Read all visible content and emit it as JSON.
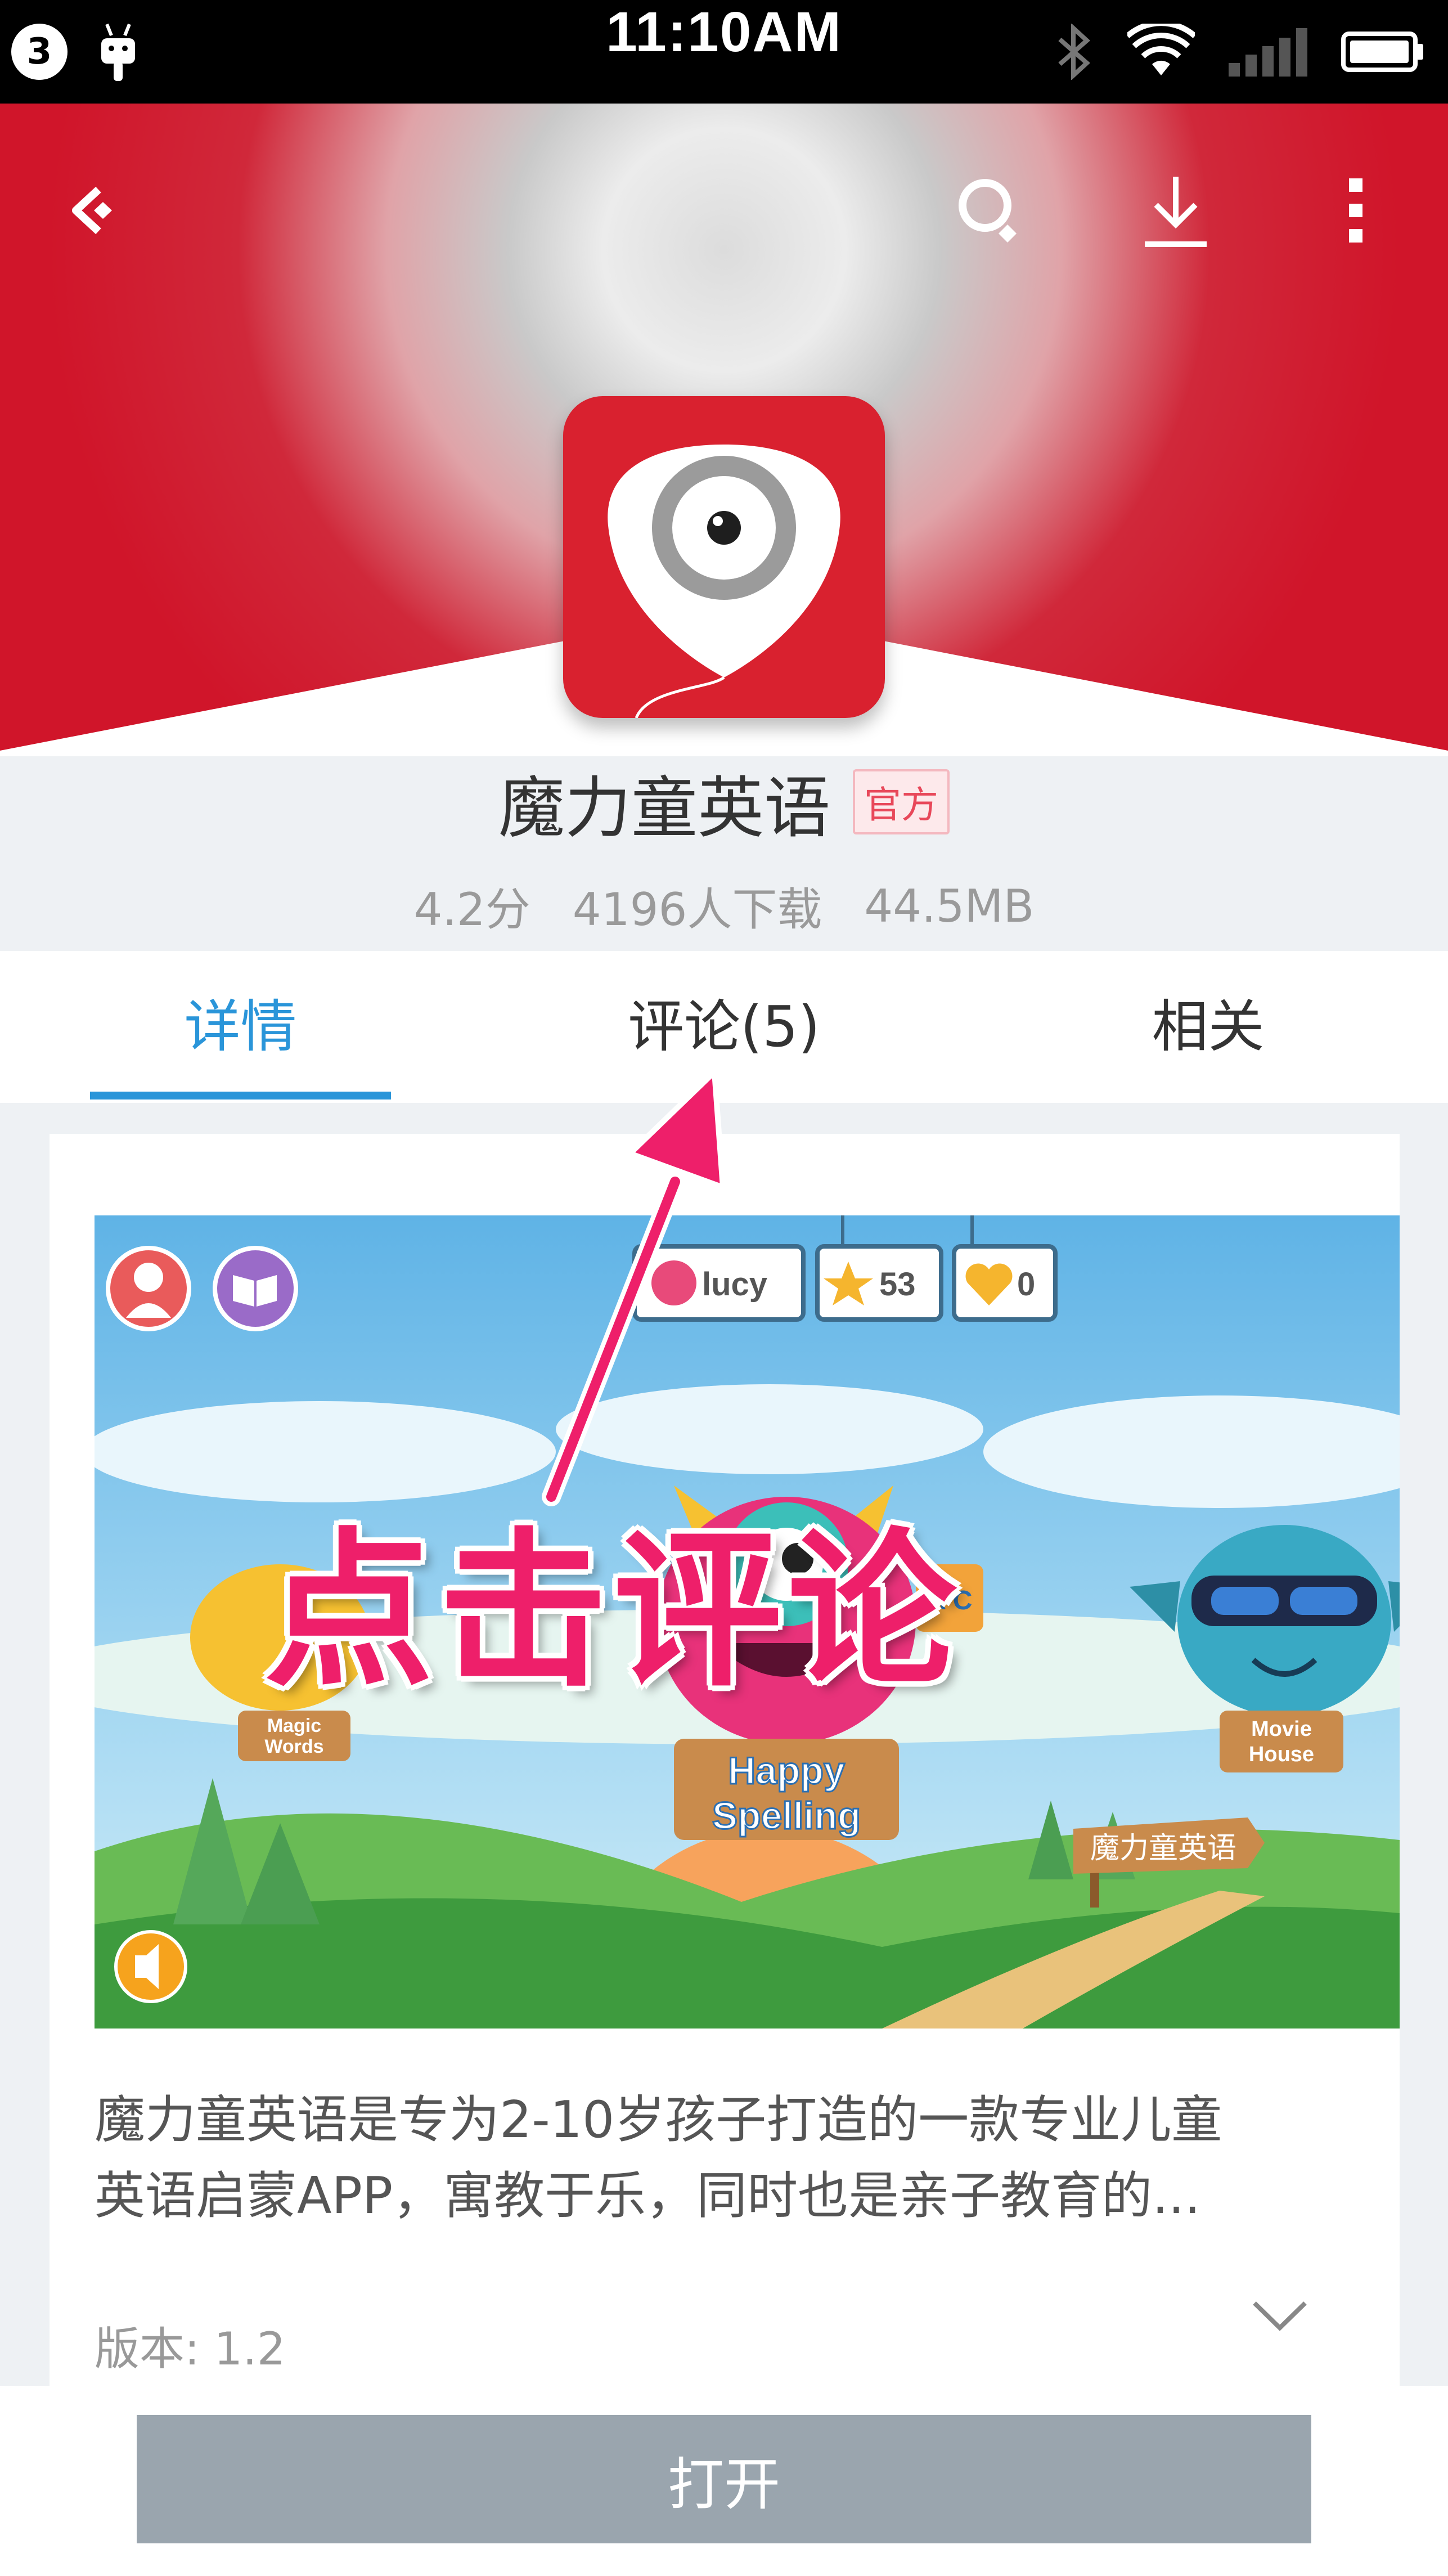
{
  "status_bar": {
    "notification_count": "3",
    "time": "11:10AM"
  },
  "app": {
    "name": "魔力童英语",
    "official_badge": "官方",
    "rating": "4.2分",
    "downloads": "4196人下载",
    "size": "44.5MB"
  },
  "tabs": [
    {
      "label": "详情",
      "active": true
    },
    {
      "label": "评论(5)",
      "active": false
    },
    {
      "label": "相关",
      "active": false
    }
  ],
  "screenshot": {
    "user_name": "lucy",
    "stars": "53",
    "hearts": "0",
    "sign_magic": "Magic Words",
    "sign_magic_1": "Magic",
    "sign_magic_2": "Words",
    "sign_happy_1": "Happy",
    "sign_happy_2": "Spelling",
    "sign_movie_1": "Movie",
    "sign_movie_2": "House",
    "sign_brand": "魔力童英语",
    "block_letters": "A  C"
  },
  "description": {
    "line1": "魔力童英语是专为2-10岁孩子打造的一款专业儿童",
    "line2": "英语启蒙APP，寓教于乐，同时也是亲子教育的..."
  },
  "version": "版本: 1.2",
  "open_button": "打开",
  "annotation": "点击评论",
  "colors": {
    "brand_red": "#d9212f",
    "tab_active": "#2a95d9",
    "open_button": "#9aa5ae",
    "annotation": "#ee1f6a"
  },
  "icons": {
    "back": "back-arrow-icon",
    "search": "search-icon",
    "download": "download-icon",
    "more": "more-vert-icon",
    "expand": "chevron-down-icon"
  }
}
